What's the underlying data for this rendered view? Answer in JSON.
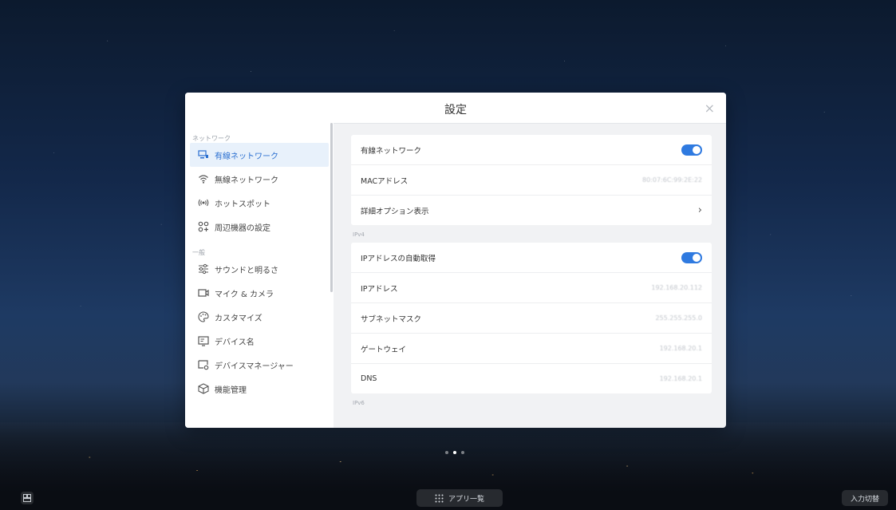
{
  "dialog": {
    "title": "設定",
    "close_glyph": "×"
  },
  "sidebar": {
    "section_network": "ネットワーク",
    "items_network": [
      {
        "label": "有線ネットワーク",
        "icon": "monitor-network-icon",
        "active": true
      },
      {
        "label": "無線ネットワーク",
        "icon": "wifi-icon",
        "active": false
      },
      {
        "label": "ホットスポット",
        "icon": "hotspot-icon",
        "active": false
      },
      {
        "label": "周辺機器の設定",
        "icon": "peripherals-icon",
        "active": false
      }
    ],
    "section_general": "一般",
    "items_general": [
      {
        "label": "サウンドと明るさ",
        "icon": "sliders-icon"
      },
      {
        "label": "マイク & カメラ",
        "icon": "camera-icon"
      },
      {
        "label": "カスタマイズ",
        "icon": "palette-icon"
      },
      {
        "label": "デバイス名",
        "icon": "device-name-icon"
      },
      {
        "label": "デバイスマネージャー",
        "icon": "device-manager-icon"
      },
      {
        "label": "機能管理",
        "icon": "cube-icon"
      }
    ]
  },
  "main": {
    "wired_card": {
      "wired_label": "有線ネットワーク",
      "wired_enabled": true,
      "mac_label": "MACアドレス",
      "mac_value": "80:07:6C:99:2E:22",
      "details_label": "詳細オプション表示",
      "details_chevron": "›"
    },
    "ipv4_label": "IPv4",
    "ipv4_card": {
      "auto_label": "IPアドレスの自動取得",
      "auto_enabled": true,
      "ip_label": "IPアドレス",
      "ip_value": "192.168.20.112",
      "subnet_label": "サブネットマスク",
      "subnet_value": "255.255.255.0",
      "gateway_label": "ゲートウェイ",
      "gateway_value": "192.168.20.1",
      "dns_label": "DNS",
      "dns_value": "192.168.20.1"
    },
    "ipv6_label": "IPv6"
  },
  "taskbar": {
    "app_list_label": "アプリ一覧",
    "input_switch_label": "入力切替",
    "page_dots": 3,
    "active_dot": 2
  },
  "colors": {
    "accent": "#2f7ae0",
    "active_bg": "#e8f1fb"
  }
}
